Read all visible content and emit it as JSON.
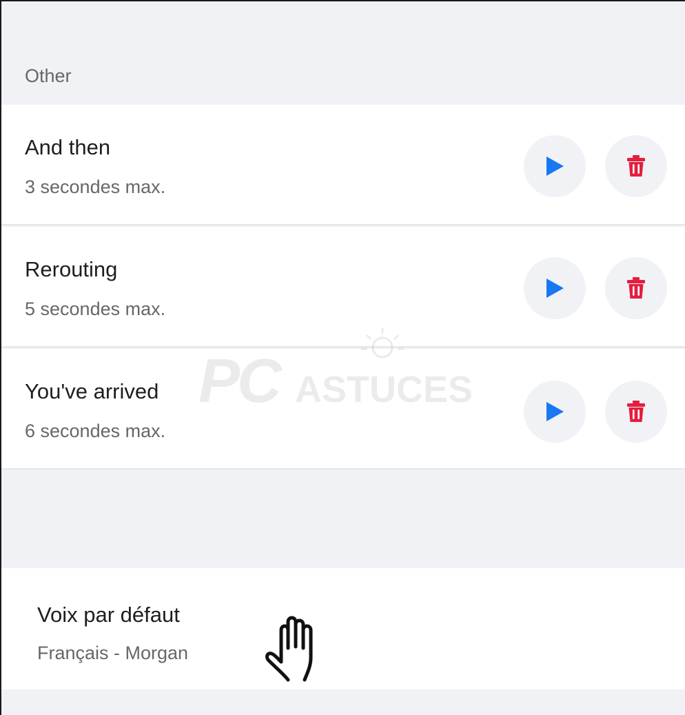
{
  "section": {
    "label": "Other"
  },
  "items": [
    {
      "title": "And then",
      "subtitle": "3 secondes max."
    },
    {
      "title": "Rerouting",
      "subtitle": "5 secondes max."
    },
    {
      "title": "You've arrived",
      "subtitle": "6 secondes max."
    }
  ],
  "default_voice": {
    "title": "Voix par défaut",
    "subtitle": "Français - Morgan"
  },
  "watermark": {
    "brand": "PC",
    "brand_rest": "ASTUCES"
  },
  "colors": {
    "play_icon": "#1877f2",
    "trash_icon": "#e41e3f",
    "button_bg": "#f0f2f5",
    "section_bg": "#f0f2f5",
    "title_text": "#1c1e21",
    "secondary_text": "#65676b"
  },
  "icons": {
    "play": "play-icon",
    "delete": "trash-icon",
    "cursor": "hand-cursor-icon"
  }
}
